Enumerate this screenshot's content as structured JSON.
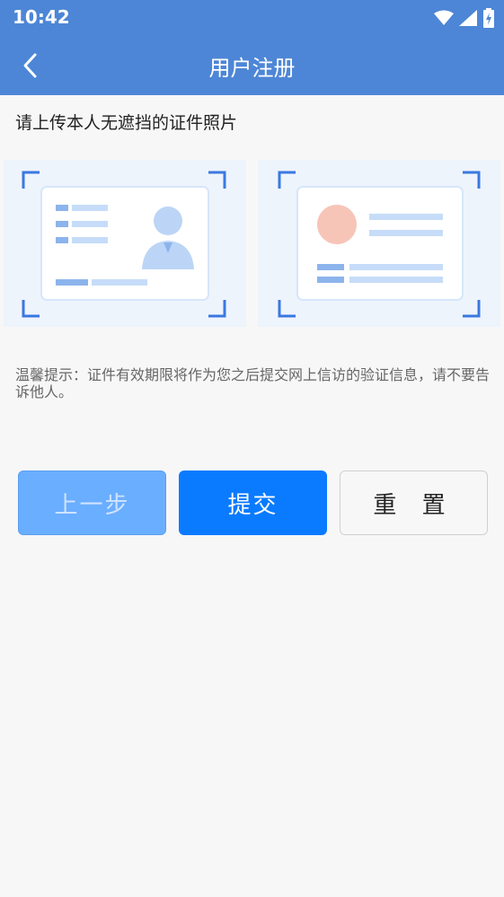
{
  "status": {
    "time": "10:42"
  },
  "header": {
    "title": "用户注册"
  },
  "main": {
    "instruction": "请上传本人无遮挡的证件照片",
    "tip": "温馨提示：证件有效期限将作为您之后提交网上信访的验证信息，请不要告诉他人。"
  },
  "actions": {
    "prev_label": "上一步",
    "submit_label": "提交",
    "reset_label": "重 置"
  },
  "colors": {
    "header_bg": "#4d86d6",
    "primary": "#0a7bff",
    "disabled": "#6aaeff",
    "frame": "#3a78e0"
  },
  "icons": [
    "back-icon",
    "wifi-icon",
    "signal-icon",
    "battery-icon",
    "id-card-front-icon",
    "id-card-back-icon"
  ]
}
